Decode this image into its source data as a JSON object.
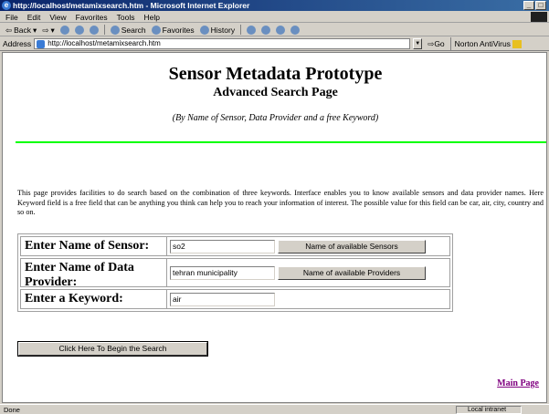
{
  "window": {
    "title": "http://localhost/metamixsearch.htm - Microsoft Internet Explorer"
  },
  "menu": {
    "items": [
      "File",
      "Edit",
      "View",
      "Favorites",
      "Tools",
      "Help"
    ]
  },
  "toolbar": {
    "back": "Back",
    "search": "Search",
    "favorites": "Favorites",
    "history": "History"
  },
  "address": {
    "label": "Address",
    "url": "http://localhost/metamixsearch.htm",
    "go": "Go",
    "norton": "Norton AntiVirus"
  },
  "page": {
    "title": "Sensor Metadata Prototype",
    "subtitle": "Advanced Search Page",
    "note": "(By Name of Sensor, Data Provider and a free Keyword)",
    "description": "This page provides facilities to do search based on the combination of three keywords. Interface enables you to know available sensors and data provider names. Here Keyword field is a free field that can be anything you think can help you to reach your information of interest. The possible value for this field can be car, air, city, country and so on.",
    "fields": {
      "sensor_label": "Enter Name of Sensor:",
      "sensor_value": "so2",
      "sensor_button": "Name of available Sensors",
      "provider_label": "Enter Name of Data Provider:",
      "provider_value": "tehran municipality",
      "provider_button": "Name of available Providers",
      "keyword_label": "Enter a Keyword:",
      "keyword_value": "air"
    },
    "submit": "Click Here To Begin the Search",
    "main_link": "Main Page"
  },
  "status": {
    "text": "Done",
    "zone": "Local intranet"
  }
}
